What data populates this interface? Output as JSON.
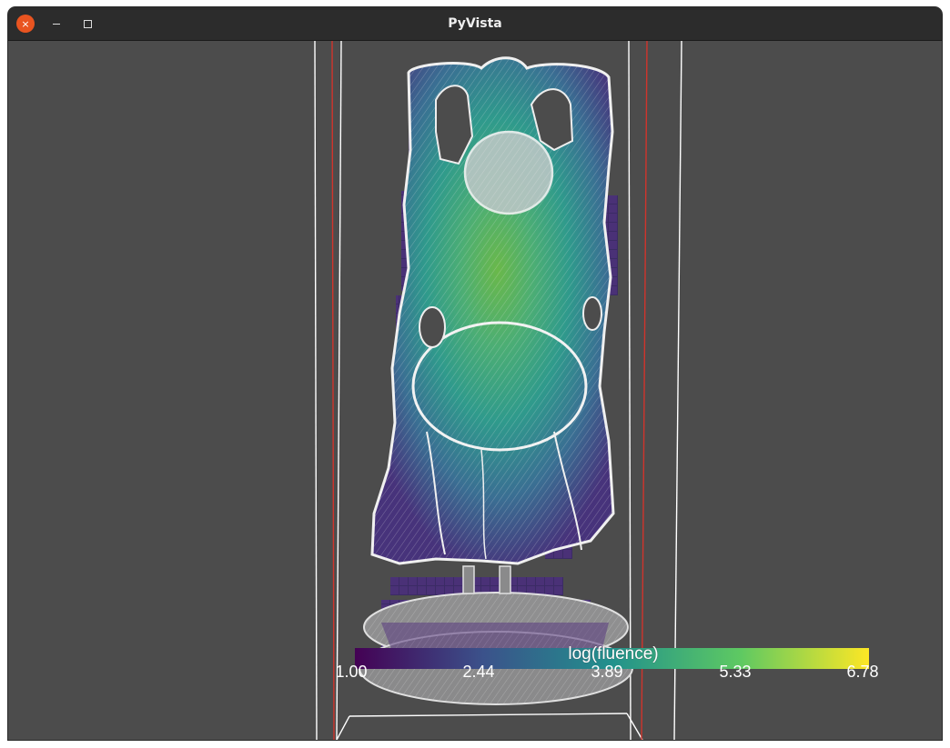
{
  "window": {
    "title": "PyVista",
    "close_symbol": "×",
    "close_icon": "close-icon",
    "minimize_icon": "minimize-icon",
    "maximize_icon": "maximize-icon"
  },
  "colorbar": {
    "title": "log(fluence)",
    "ticks": [
      "1.00",
      "2.44",
      "3.89",
      "5.33",
      "6.78"
    ],
    "range": [
      1.0,
      6.78
    ],
    "colormap": "viridis",
    "colors": [
      "#440154",
      "#3b528b",
      "#21918c",
      "#5ec962",
      "#fde725"
    ]
  },
  "scene": {
    "background_color": "#4c4c4c",
    "bounding_box_color": "#ffffff",
    "clip_plane_color": "#d0342c",
    "mesh_color": "#e8e8e8"
  }
}
